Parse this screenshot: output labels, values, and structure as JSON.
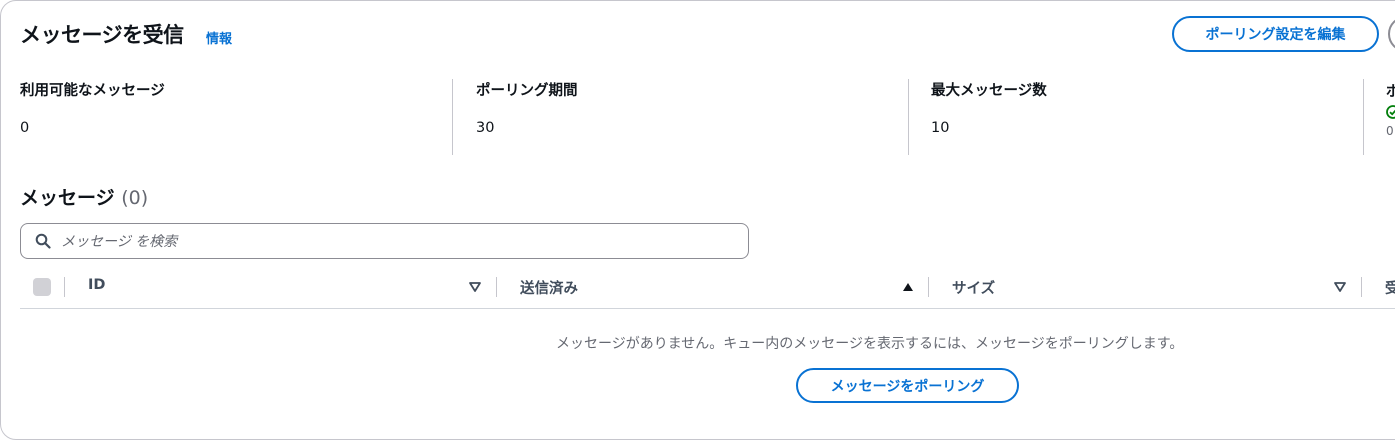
{
  "header": {
    "title": "メッセージを受信",
    "info_link": "情報",
    "edit_button": "ポーリング設定を編集"
  },
  "stats": [
    {
      "label": "利用可能なメッセージ",
      "value": "0"
    },
    {
      "label": "ポーリング期間",
      "value": "30"
    },
    {
      "label": "最大メッセージ数",
      "value": "10"
    },
    {
      "label": "ポ",
      "value": "0"
    }
  ],
  "messages": {
    "title": "メッセージ",
    "count": "(0)",
    "search_placeholder": "メッセージ を検索",
    "columns": [
      "ID",
      "送信済み",
      "サイズ",
      "受"
    ],
    "empty_text": "メッセージがありません。キュー内のメッセージを表示するには、メッセージをポーリングします。",
    "poll_button": "メッセージをポーリング"
  },
  "colors": {
    "accent": "#0972d3",
    "success": "#037f0c",
    "border": "#c6c6cd"
  },
  "icons": [
    "search-icon",
    "sort-down-icon",
    "sort-up-icon",
    "check-circle-icon"
  ]
}
